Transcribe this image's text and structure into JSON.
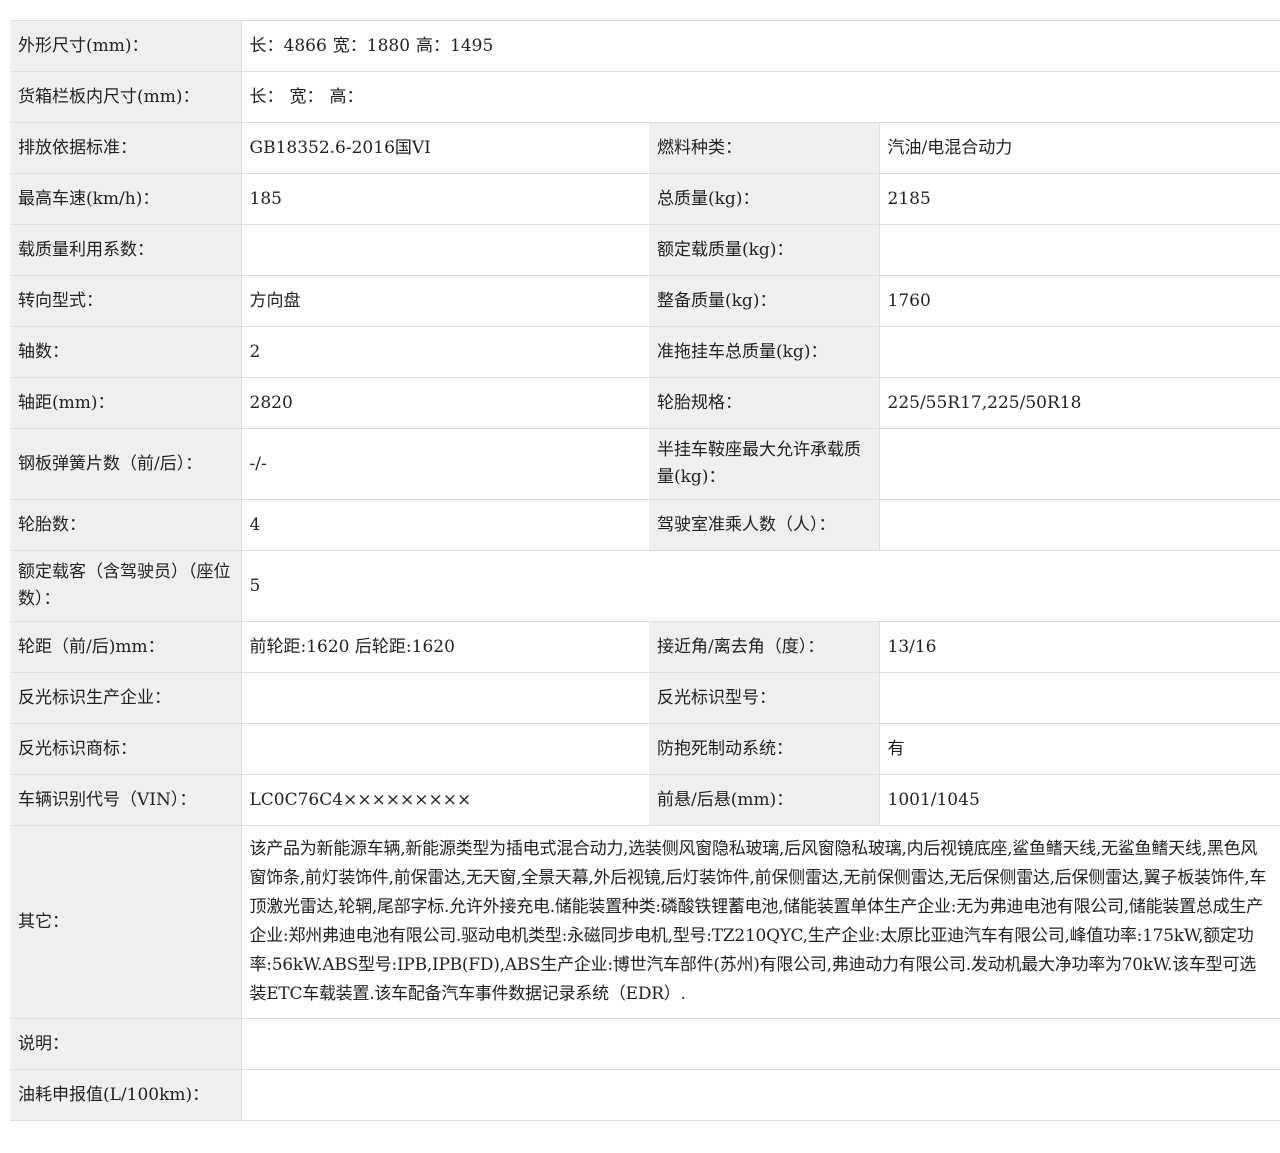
{
  "rows": {
    "dimensions": {
      "label": "外形尺寸(mm)：",
      "length_label": "长：",
      "length_value": "4866",
      "width_label": "宽：",
      "width_value": "1880",
      "height_label": "高：",
      "height_value": "1495"
    },
    "cargo_box": {
      "label": "货箱栏板内尺寸(mm)：",
      "length_label": "长：",
      "width_label": "宽：",
      "height_label": "高："
    },
    "emission": {
      "label": "排放依据标准：",
      "value": "GB18352.6-2016国VI"
    },
    "fuel": {
      "label": "燃料种类：",
      "value": "汽油/电混合动力"
    },
    "max_speed": {
      "label": "最高车速(km/h)：",
      "value": "185"
    },
    "gross_mass": {
      "label": "总质量(kg)：",
      "value": "2185"
    },
    "load_coefficient": {
      "label": "载质量利用系数：",
      "value": ""
    },
    "rated_load": {
      "label": "额定载质量(kg)：",
      "value": ""
    },
    "steering": {
      "label": "转向型式：",
      "value": "方向盘"
    },
    "curb_weight": {
      "label": "整备质量(kg)：",
      "value": "1760"
    },
    "axles": {
      "label": "轴数：",
      "value": "2"
    },
    "trailer_mass": {
      "label": "准拖挂车总质量(kg)：",
      "value": ""
    },
    "wheelbase": {
      "label": "轴距(mm)：",
      "value": "2820"
    },
    "tires": {
      "label": "轮胎规格：",
      "value": "225/55R17,225/50R18"
    },
    "leaf_springs": {
      "label": "钢板弹簧片数（前/后）：",
      "value": "-/-"
    },
    "saddle_load": {
      "label": "半挂车鞍座最大允许承载质量(kg)：",
      "value": ""
    },
    "tire_count": {
      "label": "轮胎数：",
      "value": "4"
    },
    "cab_occupants": {
      "label": "驾驶室准乘人数（人）：",
      "value": ""
    },
    "passengers": {
      "label": "额定载客（含驾驶员）（座位数）：",
      "value": "5"
    },
    "track": {
      "label": "轮距（前/后)mm：",
      "value": "前轮距:1620 后轮距:1620"
    },
    "angles": {
      "label": "接近角/离去角（度）：",
      "value": "13/16"
    },
    "reflector_maker": {
      "label": "反光标识生产企业：",
      "value": ""
    },
    "reflector_model": {
      "label": "反光标识型号：",
      "value": ""
    },
    "reflector_brand": {
      "label": "反光标识商标：",
      "value": ""
    },
    "abs": {
      "label": "防抱死制动系统：",
      "value": "有"
    },
    "vin": {
      "label": "车辆识别代号（VIN）：",
      "value": "LC0C76C4×××××××××"
    },
    "overhang": {
      "label": "前悬/后悬(mm)：",
      "value": "1001/1045"
    },
    "other": {
      "label": "其它：",
      "value": "该产品为新能源车辆,新能源类型为插电式混合动力,选装侧风窗隐私玻璃,后风窗隐私玻璃,内后视镜底座,鲨鱼鳍天线,无鲨鱼鳍天线,黑色风窗饰条,前灯装饰件,前保雷达,无天窗,全景天幕,外后视镜,后灯装饰件,前保侧雷达,无前保侧雷达,无后保侧雷达,后保侧雷达,翼子板装饰件,车顶激光雷达,轮辋,尾部字标.允许外接充电.储能装置种类:磷酸铁锂蓄电池,储能装置单体生产企业:无为弗迪电池有限公司,储能装置总成生产企业:郑州弗迪电池有限公司.驱动电机类型:永磁同步电机,型号:TZ210QYC,生产企业:太原比亚迪汽车有限公司,峰值功率:175kW,额定功率:56kW.ABS型号:IPB,IPB(FD),ABS生产企业:博世汽车部件(苏州)有限公司,弗迪动力有限公司.发动机最大净功率为70kW.该车型可选装ETC车载装置.该车配备汽车事件数据记录系统（EDR）."
    },
    "description": {
      "label": "说明：",
      "value": ""
    },
    "fuel_consumption": {
      "label": "油耗申报值(L/100km)：",
      "value": ""
    }
  }
}
